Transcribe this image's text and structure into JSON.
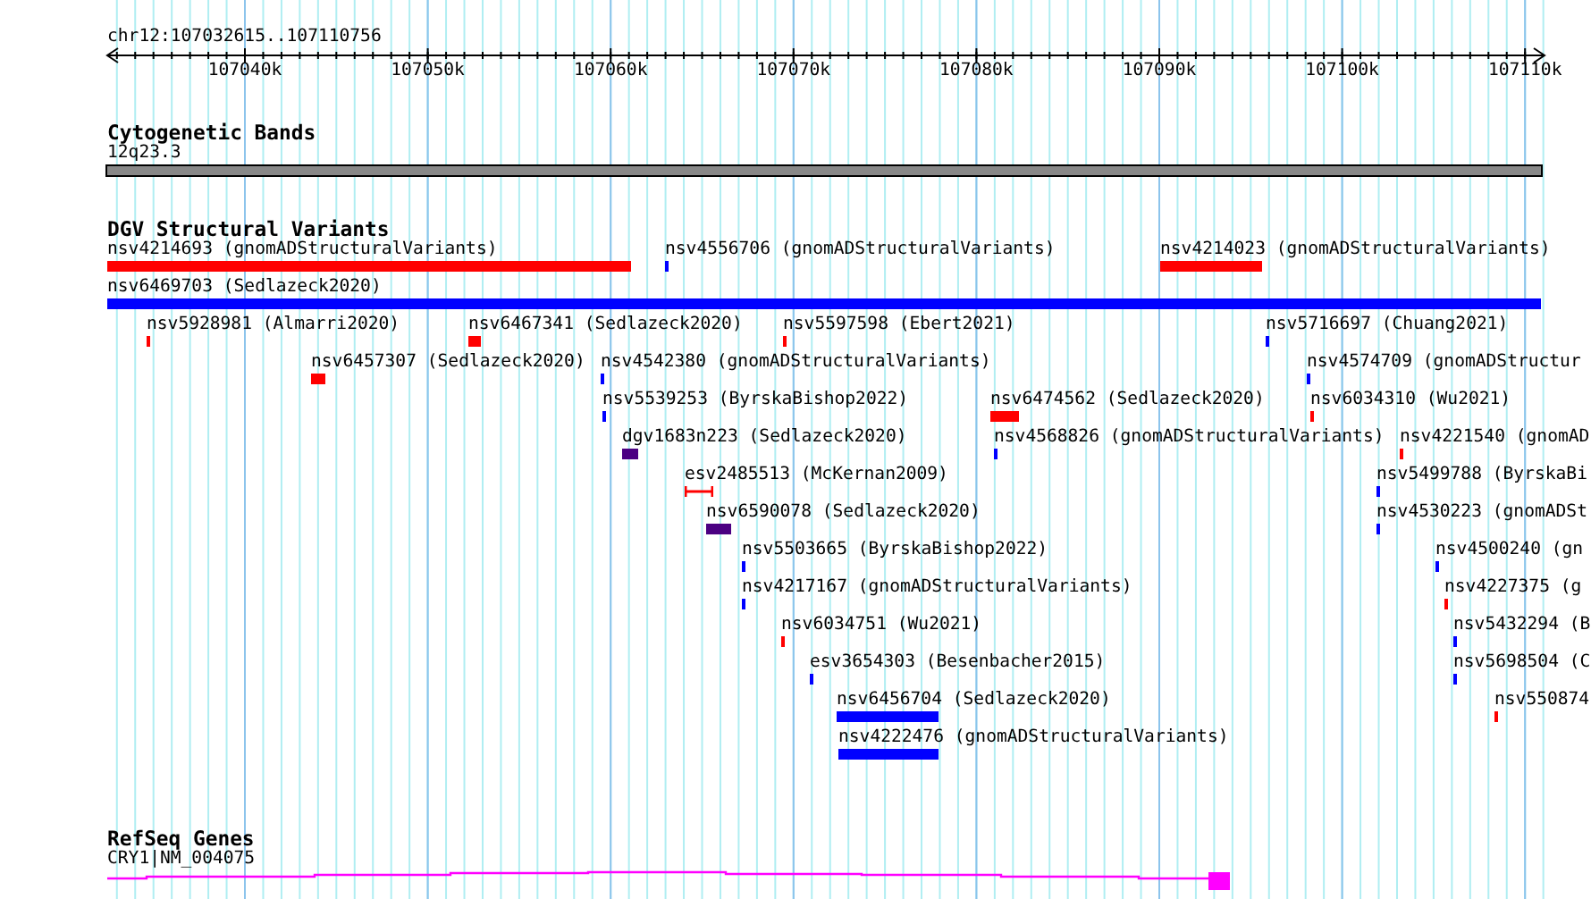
{
  "ruler": {
    "location": "chr12:107032615..107110756",
    "ticks": [
      "107040k",
      "107050k",
      "107060k",
      "107070k",
      "107080k",
      "107090k",
      "107100k",
      "107110k"
    ]
  },
  "cytogenetic_bands": {
    "title": "Cytogenetic Bands",
    "band": "12q23.3"
  },
  "dgv_structural_variants": {
    "title": "DGV Structural Variants",
    "features": [
      {
        "label": "nsv4214693 (gnomADStructuralVariants)",
        "color": "#ff0000",
        "kind": "block"
      },
      {
        "label": "nsv4556706 (gnomADStructuralVariants)",
        "color": "#0000ff",
        "kind": "block"
      },
      {
        "label": "nsv4214023 (gnomADStructuralVariants)",
        "color": "#ff0000",
        "kind": "block"
      },
      {
        "label": "nsv6469703 (Sedlazeck2020)",
        "color": "#0000ff",
        "kind": "block"
      },
      {
        "label": "nsv5928981 (Almarri2020)",
        "color": "#ff0000",
        "kind": "block"
      },
      {
        "label": "nsv6467341 (Sedlazeck2020)",
        "color": "#ff0000",
        "kind": "block"
      },
      {
        "label": "nsv5597598 (Ebert2021)",
        "color": "#ff0000",
        "kind": "block"
      },
      {
        "label": "nsv5716697 (Chuang2021)",
        "color": "#0000ff",
        "kind": "block"
      },
      {
        "label": "nsv6457307 (Sedlazeck2020)",
        "color": "#ff0000",
        "kind": "block"
      },
      {
        "label": "nsv4542380 (gnomADStructuralVariants)",
        "color": "#0000ff",
        "kind": "block"
      },
      {
        "label": "nsv4574709 (gnomADStructur",
        "color": "#0000ff",
        "kind": "block"
      },
      {
        "label": "nsv5539253 (ByrskaBishop2022)",
        "color": "#0000ff",
        "kind": "block"
      },
      {
        "label": "nsv6474562 (Sedlazeck2020)",
        "color": "#ff0000",
        "kind": "block"
      },
      {
        "label": "nsv6034310 (Wu2021)",
        "color": "#ff0000",
        "kind": "block"
      },
      {
        "label": "dgv1683n223 (Sedlazeck2020)",
        "color": "#4b0082",
        "kind": "block"
      },
      {
        "label": "nsv4568826 (gnomADStructuralVariants)",
        "color": "#0000ff",
        "kind": "block"
      },
      {
        "label": "nsv4221540 (gnomAD",
        "color": "#ff0000",
        "kind": "block"
      },
      {
        "label": "esv2485513 (McKernan2009)",
        "color": "#ff0000",
        "kind": "range"
      },
      {
        "label": "nsv5499788 (ByrskaBi",
        "color": "#0000ff",
        "kind": "block"
      },
      {
        "label": "nsv6590078 (Sedlazeck2020)",
        "color": "#4b0082",
        "kind": "block"
      },
      {
        "label": "nsv4530223 (gnomADSt",
        "color": "#0000ff",
        "kind": "block"
      },
      {
        "label": "nsv5503665 (ByrskaBishop2022)",
        "color": "#0000ff",
        "kind": "block"
      },
      {
        "label": "nsv4500240 (gn",
        "color": "#0000ff",
        "kind": "block"
      },
      {
        "label": "nsv4217167 (gnomADStructuralVariants)",
        "color": "#0000ff",
        "kind": "block"
      },
      {
        "label": "nsv4227375 (g",
        "color": "#ff0000",
        "kind": "block"
      },
      {
        "label": "nsv6034751 (Wu2021)",
        "color": "#ff0000",
        "kind": "block"
      },
      {
        "label": "nsv5432294 (B",
        "color": "#0000ff",
        "kind": "block"
      },
      {
        "label": "esv3654303 (Besenbacher2015)",
        "color": "#0000ff",
        "kind": "block"
      },
      {
        "label": "nsv5698504 (C",
        "color": "#0000ff",
        "kind": "block"
      },
      {
        "label": "nsv6456704 (Sedlazeck2020)",
        "color": "#0000ff",
        "kind": "block"
      },
      {
        "label": "nsv550874",
        "color": "#ff0000",
        "kind": "block"
      },
      {
        "label": "nsv4222476 (gnomADStructuralVariants)",
        "color": "#0000ff",
        "kind": "block"
      }
    ]
  },
  "refseq_genes": {
    "title": "RefSeq Genes",
    "genes": [
      {
        "label": "CRY1|NM_004075",
        "color": "#ff00ff"
      }
    ]
  }
}
